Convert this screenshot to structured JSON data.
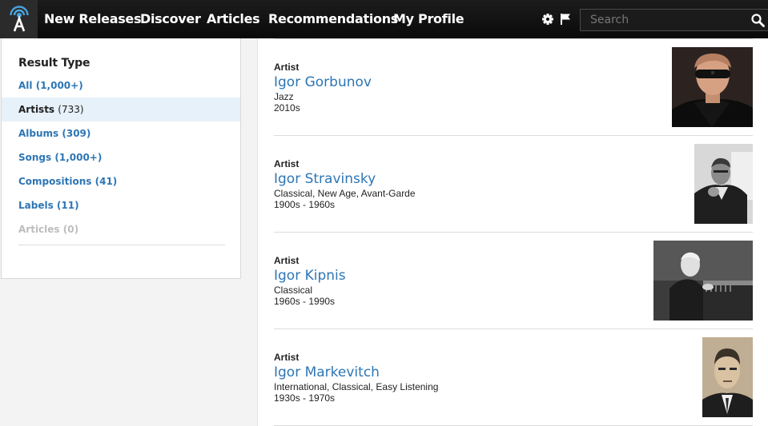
{
  "nav": {
    "logo_icon": "allmusic-antenna-icon",
    "items": [
      {
        "label": "New Releases"
      },
      {
        "label": "Discover"
      },
      {
        "label": "Articles"
      },
      {
        "label": "Recommendations"
      },
      {
        "label": "My Profile"
      }
    ],
    "settings_icon": "gear-icon",
    "flag_icon": "flag-icon",
    "search": {
      "placeholder": "Search",
      "value": "",
      "icon": "search-icon"
    }
  },
  "sidebar": {
    "heading": "Result Type",
    "filters": [
      {
        "label": "All",
        "count": "(1,000+)",
        "state": "link"
      },
      {
        "label": "Artists",
        "count": "(733)",
        "state": "active"
      },
      {
        "label": "Albums",
        "count": "(309)",
        "state": "link"
      },
      {
        "label": "Songs",
        "count": "(1,000+)",
        "state": "link"
      },
      {
        "label": "Compositions",
        "count": "(41)",
        "state": "link"
      },
      {
        "label": "Labels",
        "count": "(11)",
        "state": "link"
      },
      {
        "label": "Articles",
        "count": "(0)",
        "state": "disabled"
      }
    ]
  },
  "results": [
    {
      "type": "Artist",
      "name": "Igor Gorbunov",
      "genres": "Jazz",
      "decades": "2010s",
      "photo": "artist-photo"
    },
    {
      "type": "Artist",
      "name": "Igor Stravinsky",
      "genres": "Classical, New Age, Avant-Garde",
      "decades": "1900s - 1960s",
      "photo": "artist-photo"
    },
    {
      "type": "Artist",
      "name": "Igor Kipnis",
      "genres": "Classical",
      "decades": "1960s - 1990s",
      "photo": "artist-photo"
    },
    {
      "type": "Artist",
      "name": "Igor Markevitch",
      "genres": "International, Classical, Easy Listening",
      "decades": "1930s - 1970s",
      "photo": "artist-photo"
    }
  ],
  "colors": {
    "link": "#2d76b5",
    "topbar": "#111111",
    "active_row": "#e6f1f9",
    "disabled": "#bdbdbd"
  }
}
